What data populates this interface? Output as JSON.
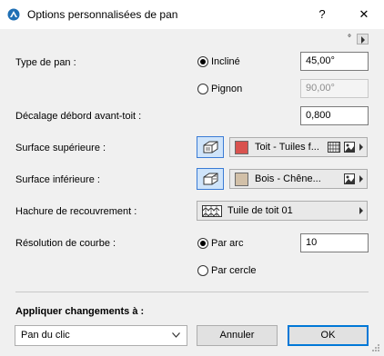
{
  "window": {
    "title": "Options personnalisées de pan",
    "help_label": "?",
    "close_label": "✕"
  },
  "units": {
    "degree_symbol": "°"
  },
  "pan_type": {
    "label": "Type de pan :",
    "incline_label": "Incliné",
    "incline_value": "45,00°",
    "pignon_label": "Pignon",
    "pignon_value": "90,00°"
  },
  "eave_offset": {
    "label": "Décalage débord avant-toit :",
    "value": "0,800"
  },
  "top_surface": {
    "label": "Surface supérieure :",
    "material": "Toit - Tuiles f...",
    "swatch_color": "#d9534f"
  },
  "bottom_surface": {
    "label": "Surface inférieure :",
    "material": "Bois - Chêne...",
    "swatch_color": "#d2c0a8"
  },
  "cover_hatch": {
    "label": "Hachure de recouvrement :",
    "value": "Tuile de toit 01"
  },
  "curve_resolution": {
    "label": "Résolution de courbe :",
    "by_arc_label": "Par arc",
    "by_arc_value": "10",
    "by_circle_label": "Par cercle"
  },
  "apply": {
    "label": "Appliquer changements à :",
    "selected": "Pan du clic"
  },
  "buttons": {
    "cancel": "Annuler",
    "ok": "OK"
  }
}
